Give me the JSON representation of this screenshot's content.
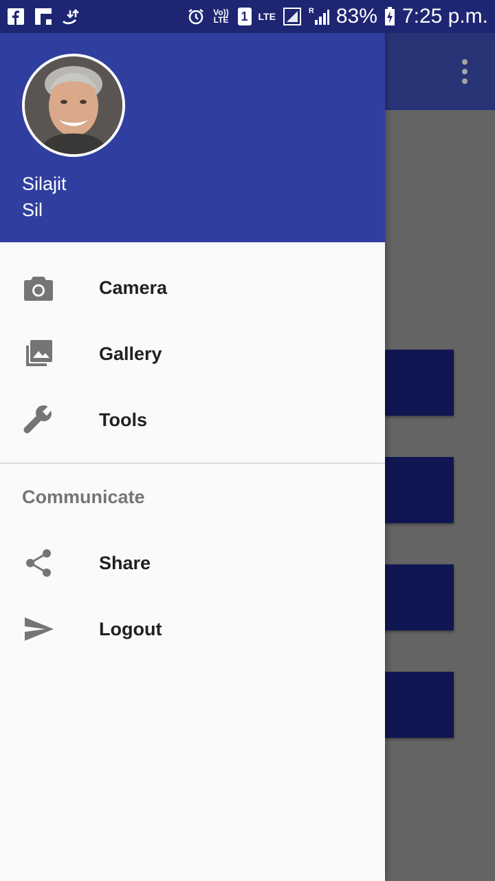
{
  "status_bar": {
    "battery_percent": "83%",
    "time": "7:25 p.m.",
    "left_icons": [
      "facebook-icon",
      "flipboard-icon",
      "data-transfer-icon"
    ],
    "volte_label": "Vo)) LTE",
    "sim_label": "1",
    "lte_label": "LTE",
    "roaming_label": "R"
  },
  "colors": {
    "primary": "#3f51b5",
    "primary_dark": "#303f9f",
    "status_bar": "#1e2673",
    "card": "#1a237e",
    "drawer_bg": "#fafafa",
    "icon_gray": "#757575",
    "text_dark": "#212121"
  },
  "header": {
    "user_first_name": "Silajit",
    "user_last_name": "Sil"
  },
  "menu": {
    "items": [
      {
        "label": "Camera",
        "icon": "camera-icon"
      },
      {
        "label": "Gallery",
        "icon": "gallery-icon"
      },
      {
        "label": "Tools",
        "icon": "wrench-icon"
      }
    ],
    "section_title": "Communicate",
    "section_items": [
      {
        "label": "Share",
        "icon": "share-icon"
      },
      {
        "label": "Logout",
        "icon": "send-icon"
      }
    ]
  }
}
